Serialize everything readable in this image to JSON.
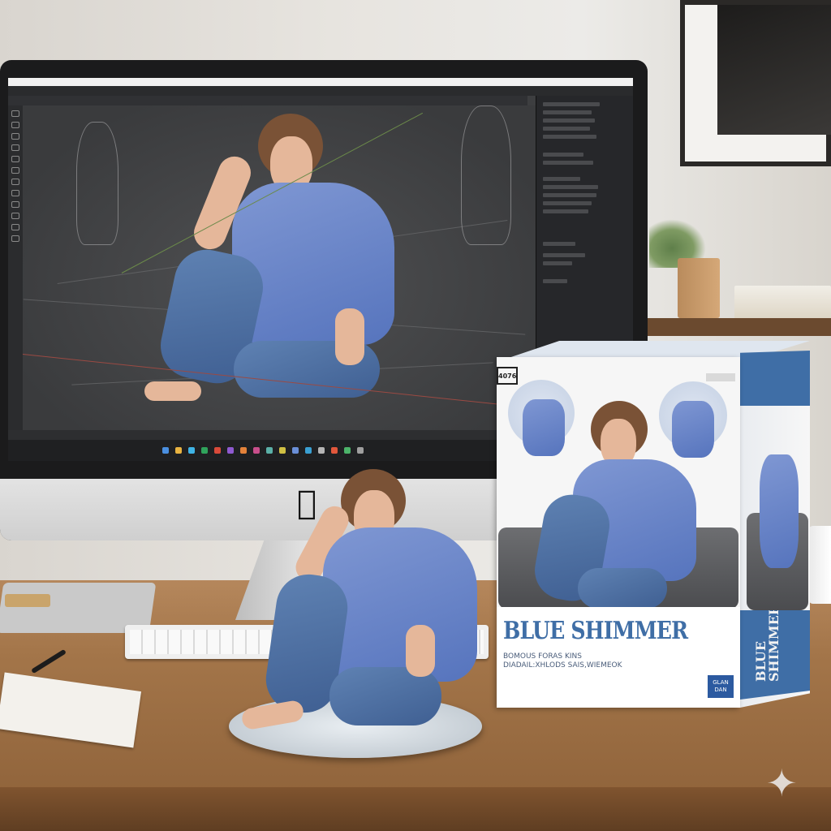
{
  "scene": {
    "monitor_brand_icon": "apple-logo-icon",
    "box": {
      "title": "BLUE SHIMMER",
      "side_title": "BLUE SHIMMER",
      "subtitle_line1": "BOMOUS FORAS KINS",
      "subtitle_line2": "DIADAIL:XHLODS SAIS,WIEMEOK",
      "logo_text": "4076",
      "brand_line1": "GLAN",
      "brand_line2": "DAN"
    },
    "overlay_icon": "sparkle-icon"
  },
  "colors": {
    "box_blue": "#3f6ea6",
    "shirt_blue": "#6f8bcf",
    "desk_wood": "#a37549"
  }
}
